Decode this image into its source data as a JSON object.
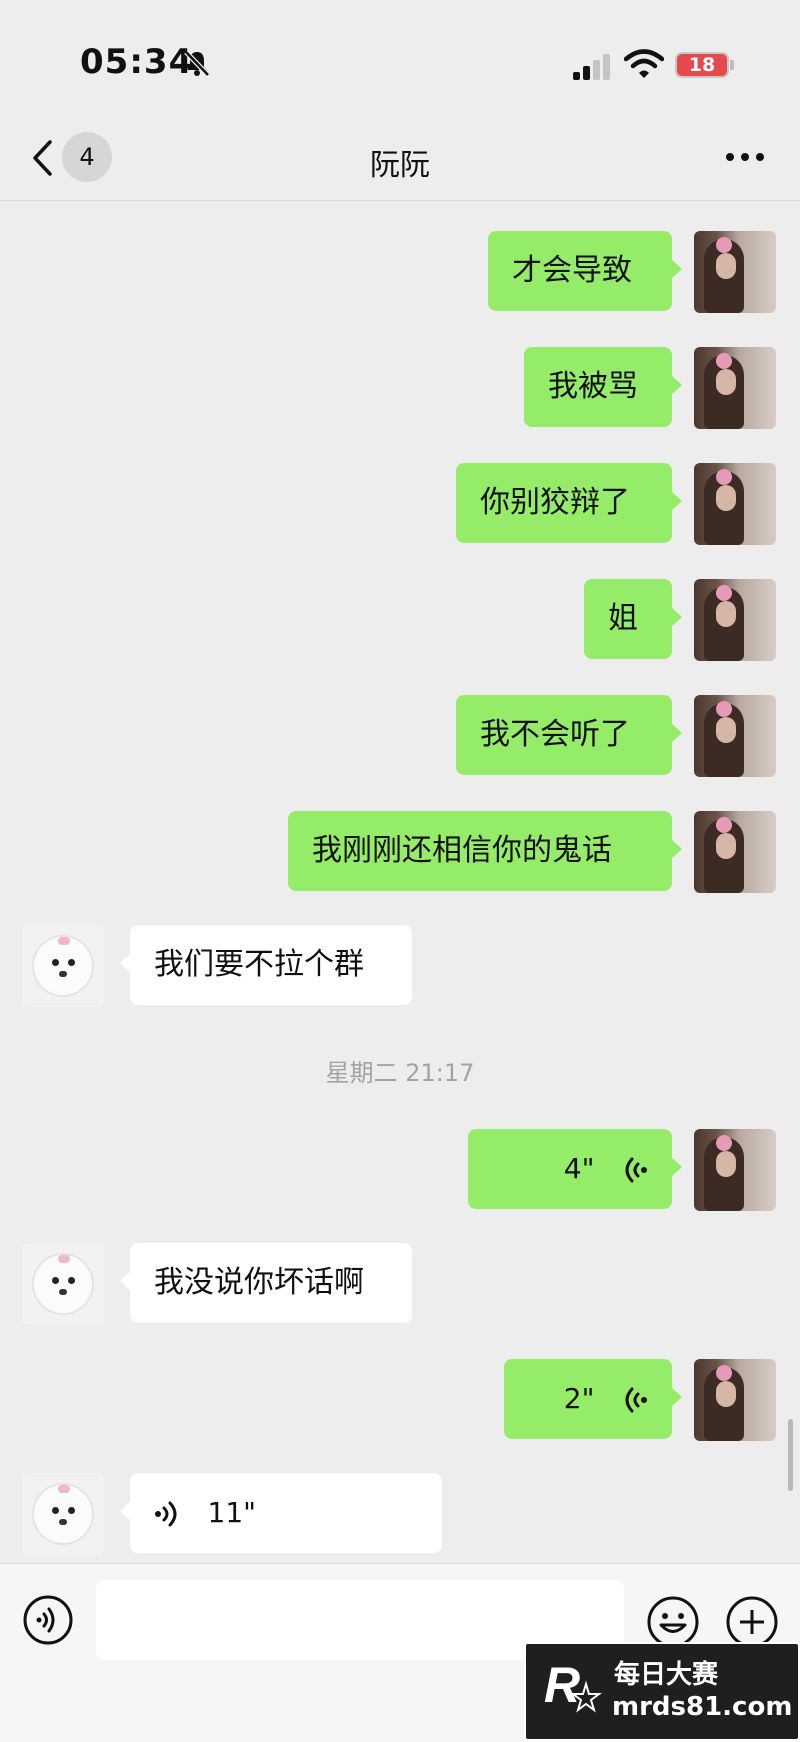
{
  "status_bar": {
    "time": "05:34",
    "battery": "18"
  },
  "header": {
    "unread_count": "4",
    "title": "阮阮"
  },
  "messages": [
    {
      "side": "out",
      "type": "text",
      "text": "才会导致"
    },
    {
      "side": "out",
      "type": "text",
      "text": "我被骂"
    },
    {
      "side": "out",
      "type": "text",
      "text": "你别狡辩了"
    },
    {
      "side": "out",
      "type": "text",
      "text": "姐"
    },
    {
      "side": "out",
      "type": "text",
      "text": "我不会听了"
    },
    {
      "side": "out",
      "type": "text",
      "text": "我刚刚还相信你的鬼话"
    },
    {
      "side": "in",
      "type": "text",
      "text": "我们要不拉个群"
    },
    {
      "type": "timestamp",
      "text": "星期二 21:17"
    },
    {
      "side": "out",
      "type": "voice",
      "duration": "4\""
    },
    {
      "side": "in",
      "type": "text",
      "text": "我没说你坏话啊"
    },
    {
      "side": "out",
      "type": "voice",
      "duration": "2\""
    },
    {
      "side": "in",
      "type": "voice",
      "duration": "11\""
    }
  ],
  "input_bar": {
    "placeholder": ""
  },
  "watermark": {
    "title": "每日大赛",
    "subtitle": "mrds81.com",
    "logo_letter": "R"
  }
}
